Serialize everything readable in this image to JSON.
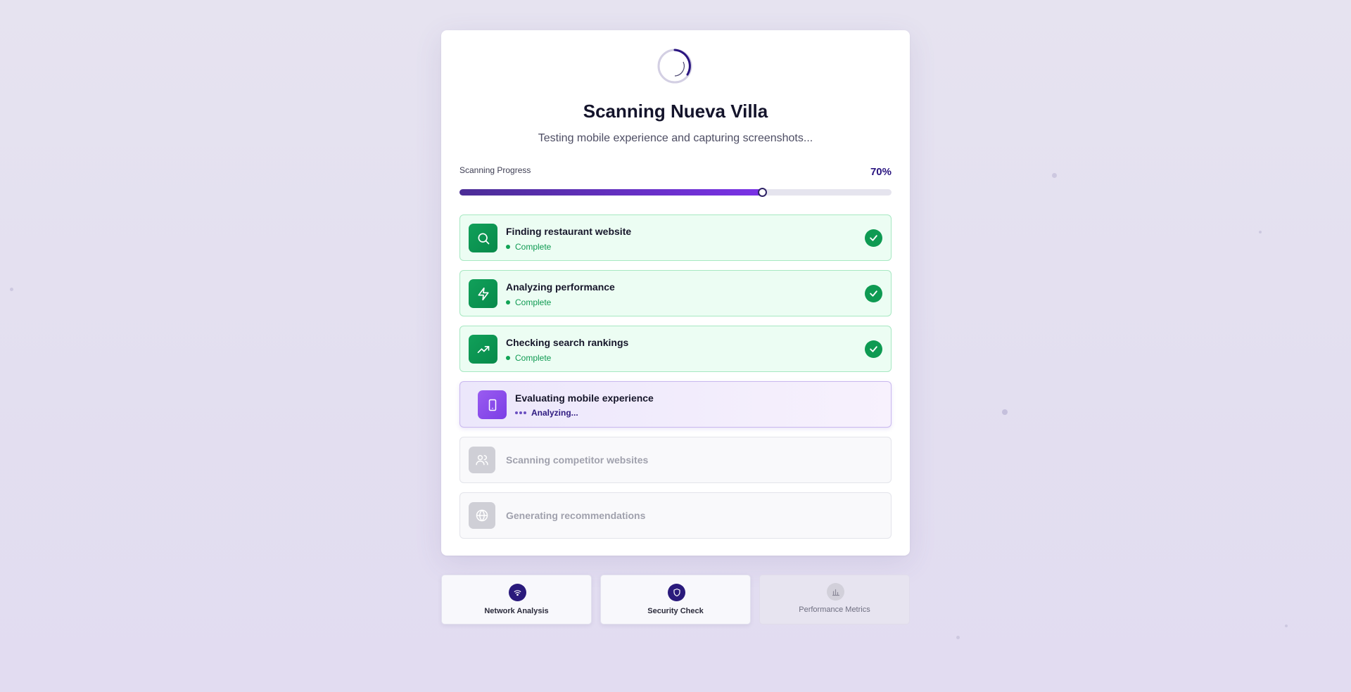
{
  "header": {
    "title": "Scanning Nueva Villa",
    "subtitle": "Testing mobile experience and capturing screenshots..."
  },
  "progress": {
    "label": "Scanning Progress",
    "percent_text": "70%",
    "value": 0.7
  },
  "steps": [
    {
      "label": "Finding restaurant website",
      "status": "Complete",
      "state": "complete",
      "icon": "search-icon"
    },
    {
      "label": "Analyzing performance",
      "status": "Complete",
      "state": "complete",
      "icon": "lightning-icon"
    },
    {
      "label": "Checking search rankings",
      "status": "Complete",
      "state": "complete",
      "icon": "trending-up-icon"
    },
    {
      "label": "Evaluating mobile experience",
      "status": "Analyzing...",
      "state": "active",
      "icon": "smartphone-icon"
    },
    {
      "label": "Scanning competitor websites",
      "status": "",
      "state": "pending",
      "icon": "users-icon"
    },
    {
      "label": "Generating recommendations",
      "status": "",
      "state": "pending",
      "icon": "globe-icon"
    }
  ],
  "modules": [
    {
      "label": "Network Analysis",
      "icon": "network-icon",
      "state": "active"
    },
    {
      "label": "Security Check",
      "icon": "shield-icon",
      "state": "active"
    },
    {
      "label": "Performance Metrics",
      "icon": "bar-chart-icon",
      "state": "inactive"
    }
  ],
  "colors": {
    "accent": "#2a1580",
    "success": "#0e9a52",
    "active_purple": "#7b3de6",
    "pending_gray": "#cfcfd6"
  }
}
